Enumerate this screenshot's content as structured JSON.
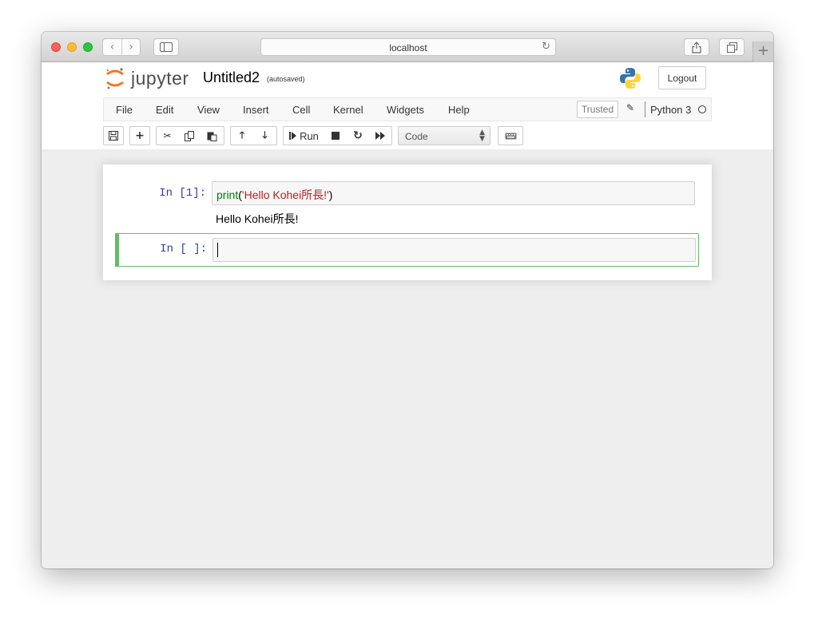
{
  "browser": {
    "url": "localhost",
    "traffic_lights": {
      "close": "#fe5f57",
      "minimize": "#febc2e",
      "zoom": "#28c840"
    }
  },
  "header": {
    "logo_text": "jupyter",
    "notebook_name": "Untitled2",
    "autosave_status": "(autosaved)",
    "logout_label": "Logout"
  },
  "menu": {
    "items": [
      "File",
      "Edit",
      "View",
      "Insert",
      "Cell",
      "Kernel",
      "Widgets",
      "Help"
    ],
    "trusted_label": "Trusted",
    "kernel_name": "Python 3"
  },
  "toolbar": {
    "run_label": "Run",
    "cell_type": "Code"
  },
  "cells": [
    {
      "prompt": "In [1]:",
      "code_func": "print",
      "code_open": "(",
      "code_string": "'Hello Kohei所長!'",
      "code_close": ")",
      "output": "Hello Kohei所長!"
    },
    {
      "prompt": "In [ ]:",
      "code": ""
    }
  ],
  "colors": {
    "prompt": "#303F9F",
    "keyword": "#008000",
    "string": "#BA2121",
    "selected_cell_border": "#66bb6a",
    "jupyter_orange": "#F37726"
  }
}
